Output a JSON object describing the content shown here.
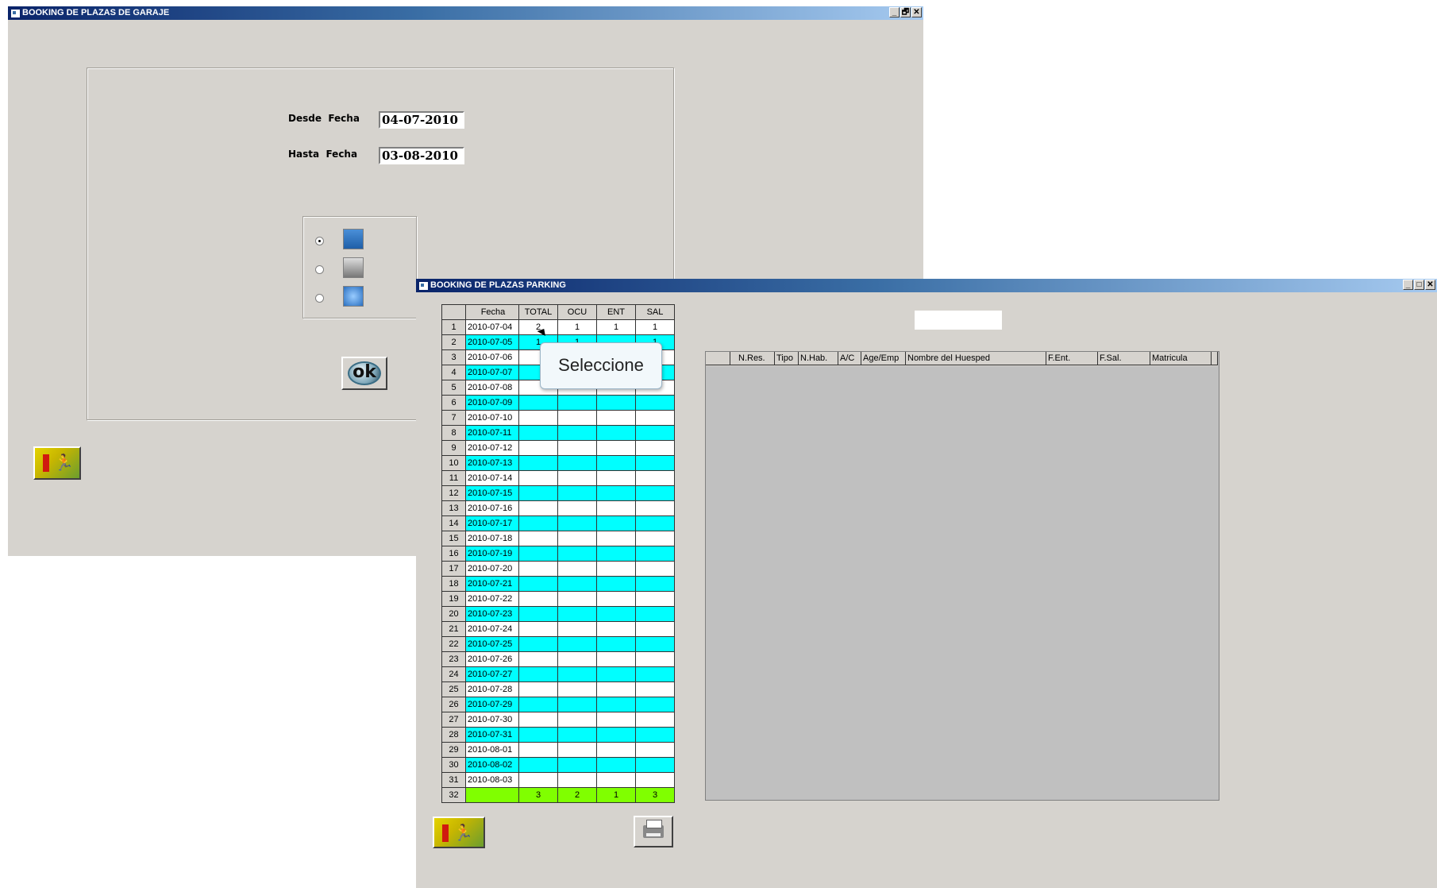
{
  "win1": {
    "title": "BOOKING DE PLAZAS DE GARAJE",
    "controls": [
      "_",
      "🗗",
      "✕"
    ],
    "desde_label": "Desde  Fecha",
    "desde_value": "04-07-2010",
    "hasta_label": "Hasta  Fecha",
    "hasta_value": "03-08-2010",
    "output_options": [
      "screen-icon",
      "printer-icon",
      "internet-icon"
    ],
    "selected_option": 0,
    "ok_label": "ok"
  },
  "win2": {
    "title": "BOOKING DE PLAZAS PARKING",
    "controls": [
      "_",
      "□",
      "✕"
    ],
    "left_grid": {
      "headers": [
        "",
        "Fecha",
        "TOTAL",
        "OCU",
        "ENT",
        "SAL"
      ],
      "rows": [
        [
          "1",
          "2010-07-04",
          "2",
          "1",
          "1",
          "1"
        ],
        [
          "2",
          "2010-07-05",
          "1",
          "1",
          "",
          "1"
        ],
        [
          "3",
          "2010-07-06",
          "",
          "",
          "",
          ""
        ],
        [
          "4",
          "2010-07-07",
          "",
          "",
          "",
          ""
        ],
        [
          "5",
          "2010-07-08",
          "",
          "",
          "",
          ""
        ],
        [
          "6",
          "2010-07-09",
          "",
          "",
          "",
          ""
        ],
        [
          "7",
          "2010-07-10",
          "",
          "",
          "",
          ""
        ],
        [
          "8",
          "2010-07-11",
          "",
          "",
          "",
          ""
        ],
        [
          "9",
          "2010-07-12",
          "",
          "",
          "",
          ""
        ],
        [
          "10",
          "2010-07-13",
          "",
          "",
          "",
          ""
        ],
        [
          "11",
          "2010-07-14",
          "",
          "",
          "",
          ""
        ],
        [
          "12",
          "2010-07-15",
          "",
          "",
          "",
          ""
        ],
        [
          "13",
          "2010-07-16",
          "",
          "",
          "",
          ""
        ],
        [
          "14",
          "2010-07-17",
          "",
          "",
          "",
          ""
        ],
        [
          "15",
          "2010-07-18",
          "",
          "",
          "",
          ""
        ],
        [
          "16",
          "2010-07-19",
          "",
          "",
          "",
          ""
        ],
        [
          "17",
          "2010-07-20",
          "",
          "",
          "",
          ""
        ],
        [
          "18",
          "2010-07-21",
          "",
          "",
          "",
          ""
        ],
        [
          "19",
          "2010-07-22",
          "",
          "",
          "",
          ""
        ],
        [
          "20",
          "2010-07-23",
          "",
          "",
          "",
          ""
        ],
        [
          "21",
          "2010-07-24",
          "",
          "",
          "",
          ""
        ],
        [
          "22",
          "2010-07-25",
          "",
          "",
          "",
          ""
        ],
        [
          "23",
          "2010-07-26",
          "",
          "",
          "",
          ""
        ],
        [
          "24",
          "2010-07-27",
          "",
          "",
          "",
          ""
        ],
        [
          "25",
          "2010-07-28",
          "",
          "",
          "",
          ""
        ],
        [
          "26",
          "2010-07-29",
          "",
          "",
          "",
          ""
        ],
        [
          "27",
          "2010-07-30",
          "",
          "",
          "",
          ""
        ],
        [
          "28",
          "2010-07-31",
          "",
          "",
          "",
          ""
        ],
        [
          "29",
          "2010-08-01",
          "",
          "",
          "",
          ""
        ],
        [
          "30",
          "2010-08-02",
          "",
          "",
          "",
          ""
        ],
        [
          "31",
          "2010-08-03",
          "",
          "",
          "",
          ""
        ],
        [
          "32",
          "",
          "3",
          "2",
          "1",
          "3"
        ]
      ]
    },
    "right_grid": {
      "headers": [
        "",
        "N.Res.",
        "Tipo",
        "N.Hab.",
        "A/C",
        "Age/Emp",
        "Nombre del Huesped",
        "F.Ent.",
        "F.Sal.",
        "Matricula",
        ""
      ]
    },
    "tooltip": "Seleccione",
    "colors": {
      "cyan": "#00ffff",
      "green": "#80ff00",
      "face": "#d6d3ce"
    }
  }
}
